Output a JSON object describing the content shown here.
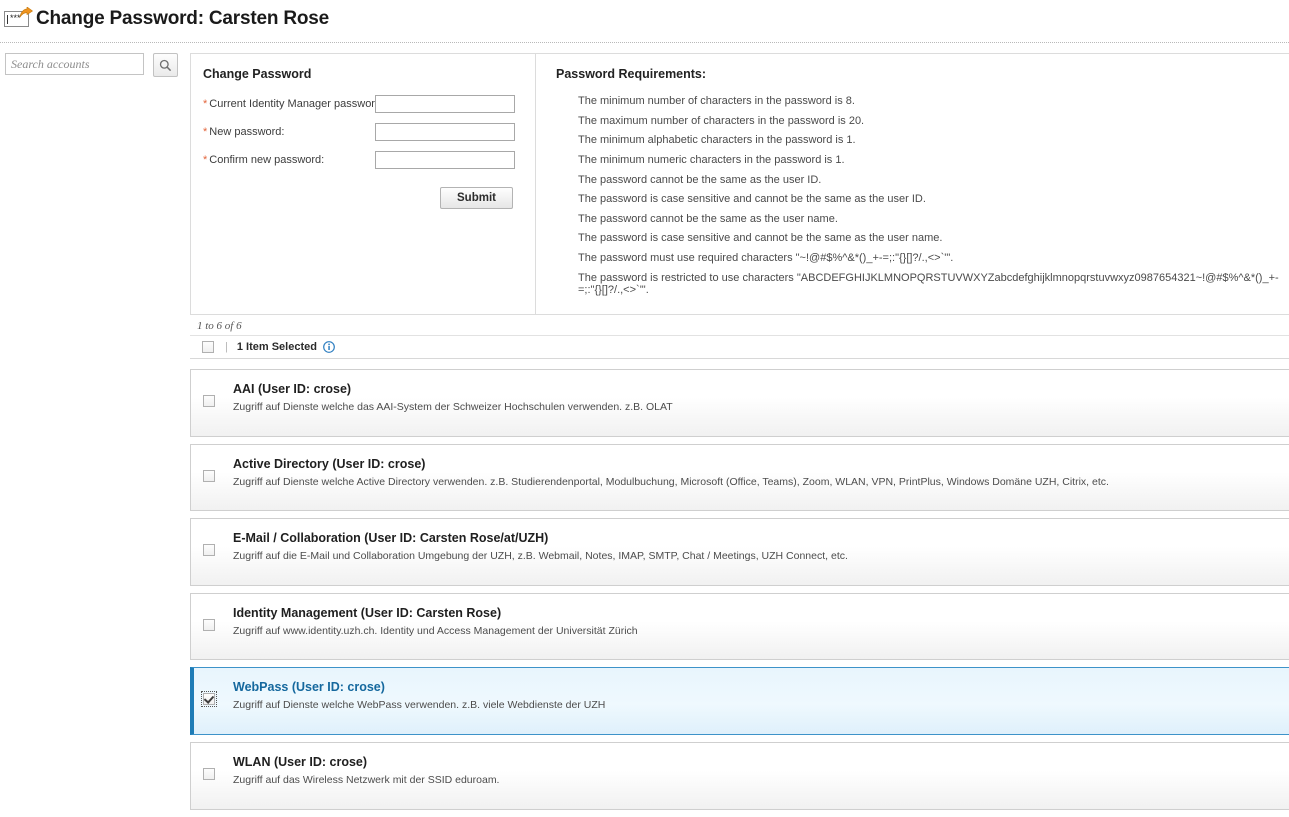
{
  "header": {
    "title": "Change Password: Carsten Rose",
    "icon": "password-change-icon"
  },
  "search": {
    "placeholder": "Search accounts",
    "value": "",
    "button_icon": "search-icon"
  },
  "change_password_panel": {
    "heading": "Change Password",
    "fields": [
      {
        "label": "Current Identity Manager password:",
        "required_marker": "*",
        "value": "",
        "name": "current-password-field"
      },
      {
        "label": "New password:",
        "required_marker": "*",
        "value": "",
        "name": "new-password-field"
      },
      {
        "label": "Confirm new password:",
        "required_marker": "*",
        "value": "",
        "name": "confirm-password-field"
      }
    ],
    "submit_label": "Submit"
  },
  "requirements_panel": {
    "heading": "Password Requirements:",
    "items": [
      "The minimum number of characters in the password is 8.",
      "The maximum number of characters in the password is 20.",
      "The minimum alphabetic characters in the password is 1.",
      "The minimum numeric characters in the password is 1.",
      "The password cannot be the same as the user ID.",
      "The password is case sensitive and cannot be the same as the user ID.",
      "The password cannot be the same as the user name.",
      "The password is case sensitive and cannot be the same as the user name.",
      "The password must use required characters \"~!@#$%^&*()_+-=;:\"{}[]?/.,<>`'\".",
      "The password is restricted to use characters \"ABCDEFGHIJKLMNOPQRSTUVWXYZabcdefghijklmnopqrstuvwxyz0987654321~!@#$%^&*()_+-=;:\"{}[]?/.,<>`'\"."
    ]
  },
  "results": {
    "count_text": "1 to 6 of 6",
    "select_all_checked": false,
    "selected_text": "1 Item Selected",
    "separator": "|",
    "info_icon": "info-icon"
  },
  "accounts": [
    {
      "title": "AAI (User ID: crose)",
      "description": "Zugriff auf Dienste welche das AAI-System der Schweizer Hochschulen verwenden. z.B. OLAT",
      "checked": false
    },
    {
      "title": "Active Directory (User ID: crose)",
      "description": "Zugriff auf Dienste welche Active Directory verwenden. z.B. Studierendenportal, Modulbuchung, Microsoft (Office, Teams), Zoom, WLAN, VPN, PrintPlus, Windows Domäne UZH, Citrix, etc.",
      "checked": false
    },
    {
      "title": "E-Mail / Collaboration (User ID: Carsten Rose/at/UZH)",
      "description": "Zugriff auf die E-Mail und Collaboration Umgebung der UZH, z.B. Webmail, Notes, IMAP, SMTP, Chat / Meetings, UZH Connect, etc.",
      "checked": false
    },
    {
      "title": "Identity Management (User ID: Carsten Rose)",
      "description": "Zugriff auf www.identity.uzh.ch. Identity und Access Management der Universität Zürich",
      "checked": false
    },
    {
      "title": "WebPass (User ID: crose)",
      "description": "Zugriff auf Dienste welche WebPass verwenden. z.B. viele Webdienste der UZH",
      "checked": true
    },
    {
      "title": "WLAN (User ID: crose)",
      "description": "Zugriff auf das Wireless Netzwerk mit der SSID eduroam.",
      "checked": false
    }
  ],
  "colors": {
    "accent_blue": "#15689e",
    "selected_border": "#1f7cb6",
    "required_star": "#e2643b",
    "icon_orange": "#f5a623"
  }
}
